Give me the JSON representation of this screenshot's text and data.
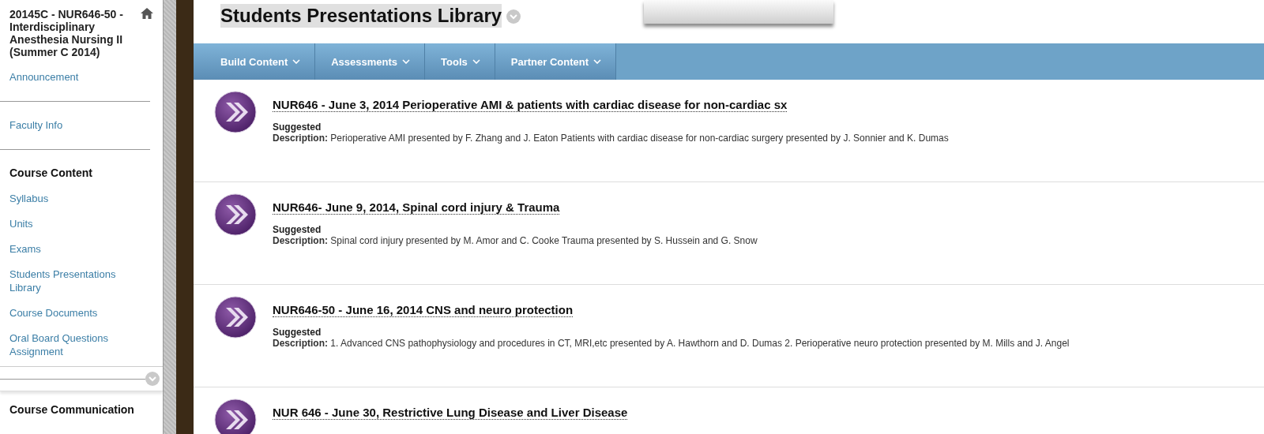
{
  "sidebar": {
    "items": [
      {
        "kind": "title",
        "label": "20145C - NUR646-50 - Interdisciplinary Anesthesia Nursing II (Summer C 2014)"
      },
      {
        "kind": "link",
        "label": "Announcement"
      },
      {
        "kind": "divider"
      },
      {
        "kind": "link",
        "label": "Faculty Info"
      },
      {
        "kind": "divider"
      },
      {
        "kind": "heading",
        "label": "Course Content"
      },
      {
        "kind": "link",
        "label": "Syllabus"
      },
      {
        "kind": "link",
        "label": "Units"
      },
      {
        "kind": "link",
        "label": "Exams"
      },
      {
        "kind": "link",
        "label": "Students Presentations Library"
      },
      {
        "kind": "link",
        "label": "Course Documents"
      },
      {
        "kind": "link",
        "label": "Oral Board Questions Assignment"
      },
      {
        "kind": "collapse"
      },
      {
        "kind": "heading",
        "label": "Course Communication"
      }
    ]
  },
  "page": {
    "title": "Students Presentations Library"
  },
  "toolbar": {
    "menus": [
      "Build Content",
      "Assessments",
      "Tools",
      "Partner Content"
    ]
  },
  "items": [
    {
      "title": "NUR646 - June 3, 2014 Perioperative AMI & patients with cardiac disease for non-cardiac sx",
      "status": "Suggested",
      "description_label": "Description:",
      "description": "Perioperative AMI presented by F. Zhang and J. Eaton Patients with cardiac disease for non-cardiac surgery presented by J. Sonnier and K. Dumas"
    },
    {
      "title": "NUR646- June 9, 2014, Spinal cord injury & Trauma",
      "status": "Suggested",
      "description_label": "Description:",
      "description": "Spinal cord injury presented by M. Amor and C. Cooke Trauma presented by S. Hussein and G. Snow"
    },
    {
      "title": "NUR646-50 - June 16, 2014 CNS and neuro protection",
      "status": "Suggested",
      "description_label": "Description:",
      "description": "1. Advanced CNS pathophysiology and procedures in CT, MRI,etc presented by A. Hawthorn and D. Dumas 2. Perioperative neuro protection presented by M. Mills and J. Angel"
    },
    {
      "title": "NUR 646 - June 30, Restrictive Lung Disease and Liver Disease"
    }
  ]
}
